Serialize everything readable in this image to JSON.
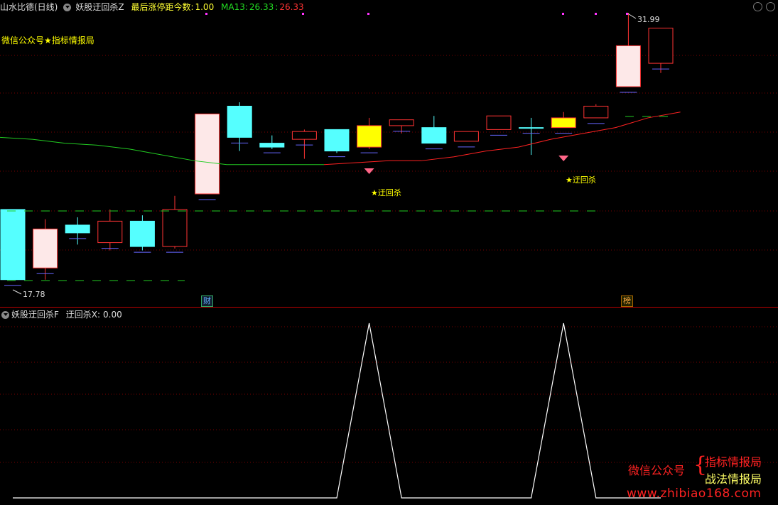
{
  "header": {
    "stock_name": "山水比德(日线)",
    "indicator_name": "妖股迂回杀Z",
    "metric_label": "最后涨停距今数:",
    "metric_value": "1.00",
    "ma_label": "MA13:",
    "ma_value": "26.33",
    "ma_value2": "26.33"
  },
  "watermark_left": "微信公众号★指标情报局",
  "price_labels": {
    "high": "31.99",
    "low": "17.78"
  },
  "signals": [
    "★迂回杀",
    "★迂回杀"
  ],
  "bottom_tags": [
    "财",
    "榜"
  ],
  "sub_panel": {
    "title": "妖股迂回杀F",
    "series_label": "迂回杀X:",
    "series_value": "0.00"
  },
  "brand": {
    "wechat": "微信公众号",
    "line1": "指标情报局",
    "line2": "战法情报局",
    "url": "www.zhibiao168.com"
  },
  "colors": {
    "up": "#ff3333",
    "down_fill": "#55ffff",
    "limit_up_fill": "#ffffff",
    "yellow_fill": "#ffff00",
    "ma_green": "#22cc22",
    "ma_red": "#ff2222",
    "signal_line": "#ffffff",
    "grid": "#7a0000"
  },
  "chart_data": {
    "type": "candlestick",
    "price_range": [
      17.78,
      31.99
    ],
    "candles": [
      {
        "o": 21.9,
        "h": 21.9,
        "l": 18.3,
        "c": 18.3,
        "style": "down"
      },
      {
        "o": 18.9,
        "h": 21.4,
        "l": 18.3,
        "c": 20.9,
        "style": "limit"
      },
      {
        "o": 21.1,
        "h": 21.5,
        "l": 20.1,
        "c": 20.7,
        "style": "down"
      },
      {
        "o": 20.2,
        "h": 21.9,
        "l": 19.8,
        "c": 21.3,
        "style": "up"
      },
      {
        "o": 21.3,
        "h": 21.6,
        "l": 19.8,
        "c": 20.0,
        "style": "down"
      },
      {
        "o": 20.0,
        "h": 22.6,
        "l": 19.9,
        "c": 21.9,
        "style": "up"
      },
      {
        "o": 22.7,
        "h": 26.8,
        "l": 22.7,
        "c": 26.8,
        "style": "limit"
      },
      {
        "o": 27.2,
        "h": 27.4,
        "l": 24.9,
        "c": 25.6,
        "style": "down"
      },
      {
        "o": 25.3,
        "h": 25.7,
        "l": 25.0,
        "c": 25.1,
        "style": "down"
      },
      {
        "o": 25.5,
        "h": 26.0,
        "l": 24.5,
        "c": 25.9,
        "style": "up"
      },
      {
        "o": 26.0,
        "h": 26.0,
        "l": 24.8,
        "c": 24.9,
        "style": "down"
      },
      {
        "o": 26.2,
        "h": 26.6,
        "l": 25.0,
        "c": 25.1,
        "style": "yellow"
      },
      {
        "o": 26.2,
        "h": 26.5,
        "l": 25.8,
        "c": 26.5,
        "style": "up"
      },
      {
        "o": 26.1,
        "h": 26.7,
        "l": 25.3,
        "c": 25.3,
        "style": "down"
      },
      {
        "o": 25.4,
        "h": 25.9,
        "l": 25.4,
        "c": 25.9,
        "style": "up"
      },
      {
        "o": 26.0,
        "h": 26.7,
        "l": 26.0,
        "c": 26.7,
        "style": "up"
      },
      {
        "o": 26.1,
        "h": 26.6,
        "l": 24.7,
        "c": 26.1,
        "style": "down"
      },
      {
        "o": 26.1,
        "h": 26.9,
        "l": 26.1,
        "c": 26.6,
        "style": "yellow"
      },
      {
        "o": 26.6,
        "h": 27.3,
        "l": 26.6,
        "c": 27.2,
        "style": "up"
      },
      {
        "o": 28.2,
        "h": 31.99,
        "l": 28.2,
        "c": 30.3,
        "style": "limit"
      },
      {
        "o": 29.4,
        "h": 31.2,
        "l": 28.9,
        "c": 31.2,
        "style": "up"
      }
    ],
    "ma13": [
      25.6,
      25.5,
      25.3,
      25.2,
      25.0,
      24.7,
      24.4,
      24.2,
      24.2,
      24.2,
      24.2,
      24.3,
      24.4,
      24.4,
      24.6,
      24.9,
      25.1,
      25.5,
      25.8,
      26.1,
      26.6,
      26.9
    ],
    "signal_series": [
      0,
      0,
      0,
      0,
      0,
      0,
      0,
      0,
      0,
      0,
      0,
      1,
      0,
      0,
      0,
      0,
      0,
      1,
      0,
      0,
      0
    ]
  }
}
